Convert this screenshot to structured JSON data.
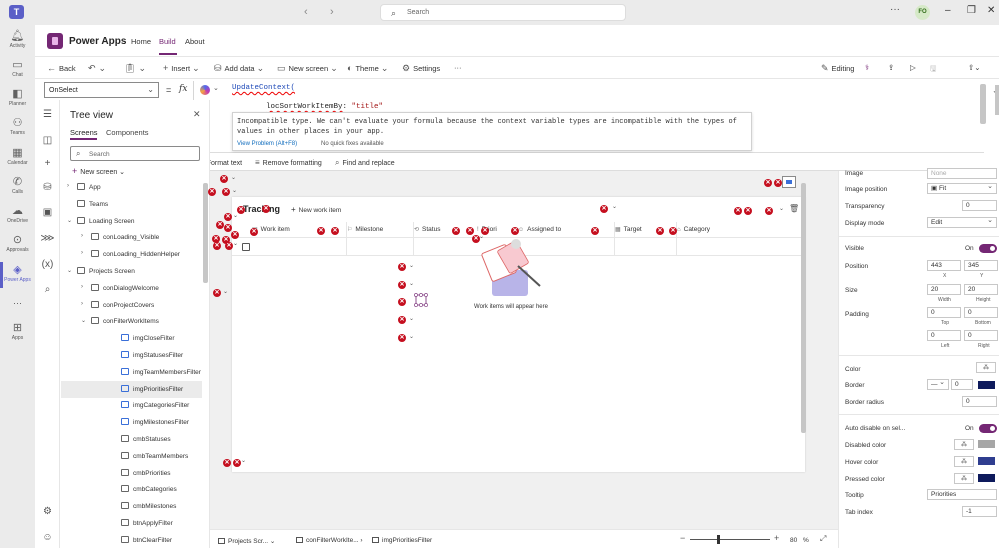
{
  "titlebar": {
    "logo": "T",
    "search_placeholder": "Search",
    "back_icon": "chevron-left-icon",
    "forward_icon": "chevron-right-icon",
    "more": "···",
    "avatar_initials": "FO",
    "minimize": "–",
    "maximize": "❐",
    "close": "✕"
  },
  "rail": {
    "items": [
      {
        "label": "Activity",
        "icon": "bell-icon"
      },
      {
        "label": "Chat",
        "icon": "chat-icon"
      },
      {
        "label": "Planner",
        "icon": "planner-icon"
      },
      {
        "label": "Teams",
        "icon": "teams-icon"
      },
      {
        "label": "Calendar",
        "icon": "calendar-icon"
      },
      {
        "label": "Calls",
        "icon": "phone-icon"
      },
      {
        "label": "OneDrive",
        "icon": "cloud-icon"
      },
      {
        "label": "Approvals",
        "icon": "approvals-icon"
      },
      {
        "label": "Power Apps",
        "icon": "power-apps-icon"
      },
      {
        "label": "···",
        "icon": "more-icon"
      },
      {
        "label": "Apps",
        "icon": "apps-icon"
      }
    ]
  },
  "header": {
    "title": "Power Apps",
    "tabs": [
      "Home",
      "Build",
      "About"
    ],
    "active_tab": "Build"
  },
  "commandbar": {
    "back": "Back",
    "insert": "Insert",
    "add_data": "Add data",
    "new_screen": "New screen",
    "theme": "Theme",
    "settings": "Settings",
    "more": "···",
    "editing": "Editing"
  },
  "formula": {
    "property": "OnSelect",
    "eq": "=",
    "fx": "fx",
    "line1": "UpdateContext(",
    "line2_name": "locSortWorkItemBy",
    "line2_colon": ": ",
    "line2_value": "\"title\"",
    "error_message": "Incompatible type. We can't evaluate your formula because the context variable types are incompatible with the types of values in other places in your app.",
    "view_problem": "View Problem (Alt+F8)",
    "no_quick_fixes": "No quick fixes available",
    "format_text": "Format text",
    "remove_formatting": "Remove formatting",
    "find_replace": "Find and replace"
  },
  "tree": {
    "title": "Tree view",
    "tab_screens": "Screens",
    "tab_components": "Components",
    "search_placeholder": "Search",
    "new_screen": "New screen",
    "items": [
      {
        "label": "App",
        "level": 0,
        "expand": "›",
        "kind": "app"
      },
      {
        "label": "Teams",
        "level": 0,
        "expand": "",
        "kind": "teams"
      },
      {
        "label": "Loading Screen",
        "level": 0,
        "expand": "⌄",
        "kind": "screen"
      },
      {
        "label": "conLoading_Visible",
        "level": 1,
        "expand": "›",
        "kind": "container"
      },
      {
        "label": "conLoading_HiddenHelper",
        "level": 1,
        "expand": "›",
        "kind": "container"
      },
      {
        "label": "Projects Screen",
        "level": 0,
        "expand": "⌄",
        "kind": "screen"
      },
      {
        "label": "conDialogWelcome",
        "level": 1,
        "expand": "›",
        "kind": "container"
      },
      {
        "label": "conProjectCovers",
        "level": 1,
        "expand": "›",
        "kind": "container"
      },
      {
        "label": "conFilterWorkItems",
        "level": 1,
        "expand": "⌄",
        "kind": "container"
      },
      {
        "label": "imgCloseFilter",
        "level": 2,
        "expand": "",
        "kind": "image"
      },
      {
        "label": "imgStatusesFilter",
        "level": 2,
        "expand": "",
        "kind": "image"
      },
      {
        "label": "imgTeamMembersFilter",
        "level": 2,
        "expand": "",
        "kind": "image"
      },
      {
        "label": "imgPrioritiesFilter",
        "level": 2,
        "expand": "",
        "kind": "image",
        "selected": true
      },
      {
        "label": "imgCategoriesFilter",
        "level": 2,
        "expand": "",
        "kind": "image"
      },
      {
        "label": "imgMilestonesFilter",
        "level": 2,
        "expand": "",
        "kind": "image"
      },
      {
        "label": "cmbStatuses",
        "level": 2,
        "expand": "",
        "kind": "combo"
      },
      {
        "label": "cmbTeamMembers",
        "level": 2,
        "expand": "",
        "kind": "combo"
      },
      {
        "label": "cmbPriorities",
        "level": 2,
        "expand": "",
        "kind": "combo"
      },
      {
        "label": "cmbCategories",
        "level": 2,
        "expand": "",
        "kind": "combo"
      },
      {
        "label": "cmbMilestones",
        "level": 2,
        "expand": "",
        "kind": "combo"
      },
      {
        "label": "btnApplyFilter",
        "level": 2,
        "expand": "",
        "kind": "button"
      },
      {
        "label": "btnClearFilter",
        "level": 2,
        "expand": "",
        "kind": "button"
      }
    ]
  },
  "canvas": {
    "title": "Tracking",
    "new_work_item": "New work item",
    "columns": [
      "Work item",
      "Milestone",
      "Status",
      "Priori",
      "Assigned to",
      "Target",
      "Category"
    ],
    "empty_text": "Work items will appear here",
    "error_glyph": "✕"
  },
  "statusbar": {
    "crumbs": [
      "Projects Scr...",
      "conFilterWorkIte...",
      "imgPrioritiesFilter"
    ],
    "zoom_value": "80",
    "zoom_unit": "%"
  },
  "properties": {
    "image_label": "Image",
    "image_value": "None",
    "image_position_label": "Image position",
    "image_position_value": "Fit",
    "transparency_label": "Transparency",
    "transparency_value": "0",
    "display_mode_label": "Display mode",
    "display_mode_value": "Edit",
    "visible_label": "Visible",
    "visible_value": "On",
    "position_label": "Position",
    "position_x": "443",
    "position_y": "345",
    "x_label": "X",
    "y_label": "Y",
    "size_label": "Size",
    "size_w": "20",
    "size_h": "20",
    "width_label": "Width",
    "height_label": "Height",
    "padding_label": "Padding",
    "padding_top": "0",
    "padding_bottom": "0",
    "padding_left": "0",
    "padding_right": "0",
    "top_label": "Top",
    "bottom_label": "Bottom",
    "left_label": "Left",
    "right_label": "Right",
    "color_label": "Color",
    "border_label": "Border",
    "border_width": "0",
    "border_radius_label": "Border radius",
    "border_radius_value": "0",
    "auto_disable_label": "Auto disable on sel...",
    "auto_disable_value": "On",
    "disabled_color_label": "Disabled color",
    "hover_color_label": "Hover color",
    "pressed_color_label": "Pressed color",
    "tooltip_label": "Tooltip",
    "tooltip_value": "Priorities",
    "tab_index_label": "Tab index",
    "tab_index_value": "-1",
    "colors": {
      "disabled": "#a6a6a6",
      "hover": "#2f3d8f",
      "pressed": "#0e1a5c",
      "border": "#0e1a5c"
    }
  },
  "colors": {
    "accent": "#742774",
    "teams": "#5b5fc7",
    "error": "#c50f1f"
  }
}
